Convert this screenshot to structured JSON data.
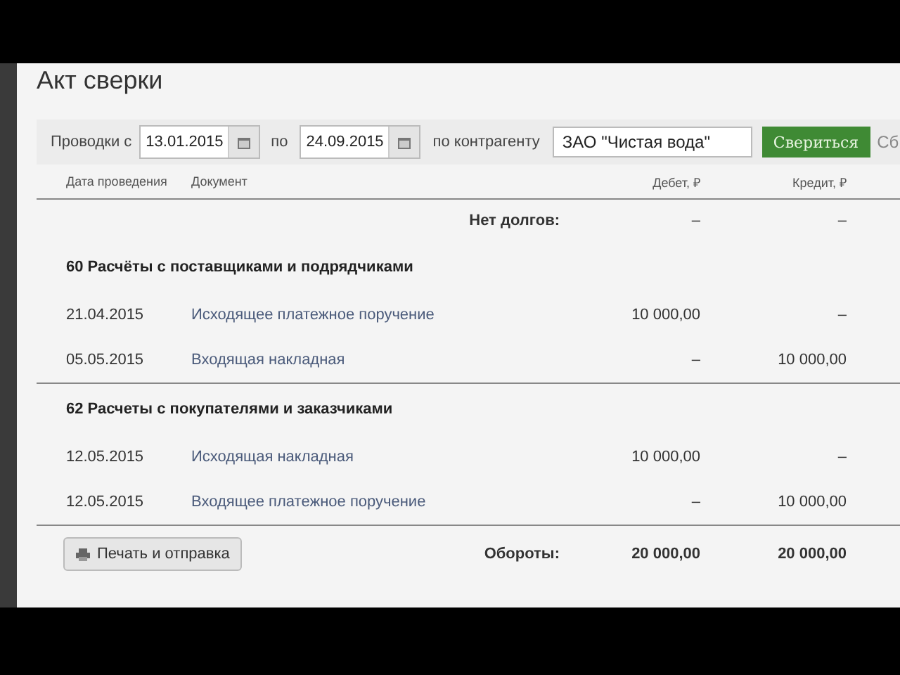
{
  "title": "Акт сверки",
  "filter": {
    "from_label": "Проводки с",
    "date_from": "13.01.2015",
    "to_label": "по",
    "date_to": "24.09.2015",
    "counterparty_label": "по контрагенту",
    "counterparty": "ЗАО \"Чистая вода\"",
    "submit_button": "Свериться",
    "cut_button": "Сб"
  },
  "columns": [
    "Дата проведения",
    "Документ",
    "Дебет, ₽",
    "Кредит, ₽"
  ],
  "opening": {
    "label": "Нет долгов:",
    "debit": "–",
    "credit": "–"
  },
  "sections": [
    {
      "title": "60 Расчёты с поставщиками и подрядчиками",
      "rows": [
        {
          "date": "21.04.2015",
          "document": "Исходящее платежное поручение",
          "debit": "10 000,00",
          "credit": "–"
        },
        {
          "date": "05.05.2015",
          "document": "Входящая накладная",
          "debit": "–",
          "credit": "10 000,00"
        }
      ]
    },
    {
      "title": "62 Расчеты с покупателями и заказчиками",
      "rows": [
        {
          "date": "12.05.2015",
          "document": "Исходящая накладная",
          "debit": "10 000,00",
          "credit": "–"
        },
        {
          "date": "12.05.2015",
          "document": "Входящее платежное поручение",
          "debit": "–",
          "credit": "10 000,00"
        }
      ]
    }
  ],
  "totals": {
    "label": "Обороты:",
    "debit": "20 000,00",
    "credit": "20 000,00"
  },
  "print_button": "Печать и отправка"
}
